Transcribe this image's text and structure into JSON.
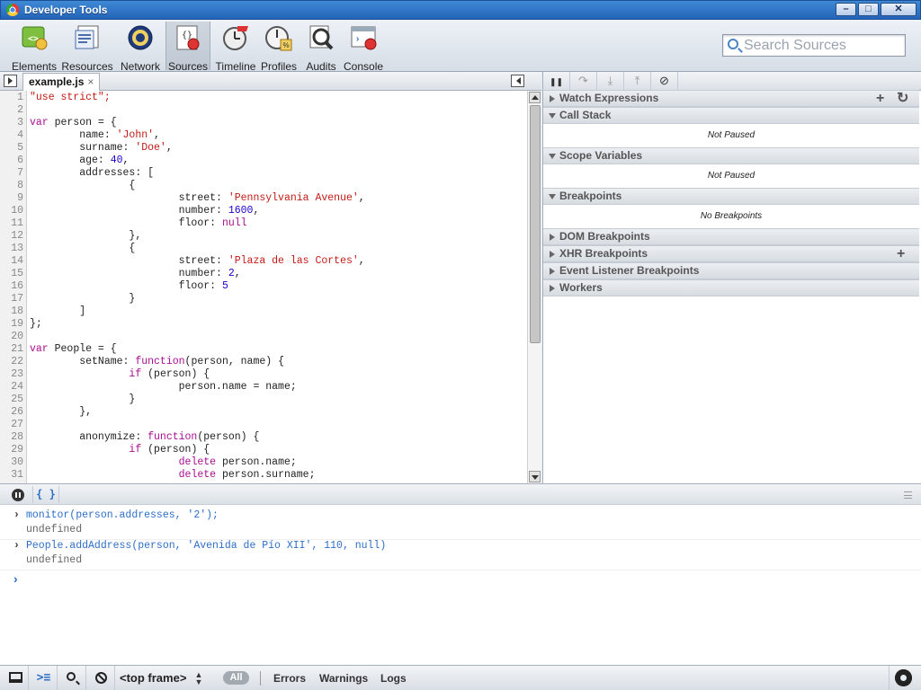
{
  "window": {
    "title": "Developer Tools"
  },
  "toolbar": {
    "items": [
      {
        "label": "Elements",
        "icon": "elements-icon"
      },
      {
        "label": "Resources",
        "icon": "resources-icon"
      },
      {
        "label": "Network",
        "icon": "network-icon"
      },
      {
        "label": "Sources",
        "icon": "sources-icon"
      },
      {
        "label": "Timeline",
        "icon": "timeline-icon"
      },
      {
        "label": "Profiles",
        "icon": "profiles-icon"
      },
      {
        "label": "Audits",
        "icon": "audits-icon"
      },
      {
        "label": "Console",
        "icon": "console-icon"
      }
    ],
    "active": "Sources",
    "search_placeholder": "Search Sources"
  },
  "editor": {
    "tab_label": "example.js",
    "tab_close": "×",
    "lines": [
      [
        [
          "s",
          "\"use strict\";"
        ]
      ],
      [],
      [
        [
          "k",
          "var"
        ],
        [
          "p",
          " person = {"
        ]
      ],
      [
        [
          "p",
          "        name: "
        ],
        [
          "s",
          "'John'"
        ],
        [
          "p",
          ","
        ]
      ],
      [
        [
          "p",
          "        surname: "
        ],
        [
          "s",
          "'Doe'"
        ],
        [
          "p",
          ","
        ]
      ],
      [
        [
          "p",
          "        age: "
        ],
        [
          "n",
          "40"
        ],
        [
          "p",
          ","
        ]
      ],
      [
        [
          "p",
          "        addresses: ["
        ]
      ],
      [
        [
          "p",
          "                {"
        ]
      ],
      [
        [
          "p",
          "                        street: "
        ],
        [
          "s",
          "'Pennsylvania Avenue'"
        ],
        [
          "p",
          ","
        ]
      ],
      [
        [
          "p",
          "                        number: "
        ],
        [
          "n",
          "1600"
        ],
        [
          "p",
          ","
        ]
      ],
      [
        [
          "p",
          "                        floor: "
        ],
        [
          "k",
          "null"
        ]
      ],
      [
        [
          "p",
          "                },"
        ]
      ],
      [
        [
          "p",
          "                {"
        ]
      ],
      [
        [
          "p",
          "                        street: "
        ],
        [
          "s",
          "'Plaza de las Cortes'"
        ],
        [
          "p",
          ","
        ]
      ],
      [
        [
          "p",
          "                        number: "
        ],
        [
          "n",
          "2"
        ],
        [
          "p",
          ","
        ]
      ],
      [
        [
          "p",
          "                        floor: "
        ],
        [
          "n",
          "5"
        ]
      ],
      [
        [
          "p",
          "                }"
        ]
      ],
      [
        [
          "p",
          "        ]"
        ]
      ],
      [
        [
          "p",
          "};"
        ]
      ],
      [],
      [
        [
          "k",
          "var"
        ],
        [
          "p",
          " People = {"
        ]
      ],
      [
        [
          "p",
          "        setName: "
        ],
        [
          "k",
          "function"
        ],
        [
          "p",
          "(person, name) {"
        ]
      ],
      [
        [
          "p",
          "                "
        ],
        [
          "k",
          "if"
        ],
        [
          "p",
          " (person) {"
        ]
      ],
      [
        [
          "p",
          "                        person.name = name;"
        ]
      ],
      [
        [
          "p",
          "                }"
        ]
      ],
      [
        [
          "p",
          "        },"
        ]
      ],
      [],
      [
        [
          "p",
          "        anonymize: "
        ],
        [
          "k",
          "function"
        ],
        [
          "p",
          "(person) {"
        ]
      ],
      [
        [
          "p",
          "                "
        ],
        [
          "k",
          "if"
        ],
        [
          "p",
          " (person) {"
        ]
      ],
      [
        [
          "p",
          "                        "
        ],
        [
          "k",
          "delete"
        ],
        [
          "p",
          " person.name;"
        ]
      ],
      [
        [
          "p",
          "                        "
        ],
        [
          "k",
          "delete"
        ],
        [
          "p",
          " person.surname;"
        ]
      ]
    ]
  },
  "debugger": {
    "buttons": [
      {
        "icon": "pause-icon",
        "glyph": "❚❚"
      },
      {
        "icon": "step-over-icon",
        "glyph": "↷"
      },
      {
        "icon": "step-into-icon",
        "glyph": "⤓"
      },
      {
        "icon": "step-out-icon",
        "glyph": "⤒"
      },
      {
        "icon": "deactivate-breakpoints-icon",
        "glyph": "⊘"
      }
    ],
    "panes": [
      {
        "title": "Watch Expressions",
        "expanded": false,
        "actions": [
          "+",
          "↻"
        ]
      },
      {
        "title": "Call Stack",
        "expanded": true,
        "body": "Not Paused"
      },
      {
        "title": "Scope Variables",
        "expanded": true,
        "body": "Not Paused"
      },
      {
        "title": "Breakpoints",
        "expanded": true,
        "body": "No Breakpoints"
      },
      {
        "title": "DOM Breakpoints",
        "expanded": false
      },
      {
        "title": "XHR Breakpoints",
        "expanded": false,
        "actions": [
          "+"
        ]
      },
      {
        "title": "Event Listener Breakpoints",
        "expanded": false
      },
      {
        "title": "Workers",
        "expanded": false
      }
    ]
  },
  "console": {
    "pretty_print": "{ }",
    "messages": [
      {
        "command": "monitor(person.addresses, '2');",
        "result": "undefined"
      },
      {
        "command": "People.addAddress(person, 'Avenida de Pío XII', 110, null)",
        "result": "undefined"
      }
    ],
    "prompt": "›"
  },
  "statusbar": {
    "frame": "<top frame>",
    "filters": [
      "All",
      "Errors",
      "Warnings",
      "Logs"
    ],
    "active_filter": "All"
  }
}
